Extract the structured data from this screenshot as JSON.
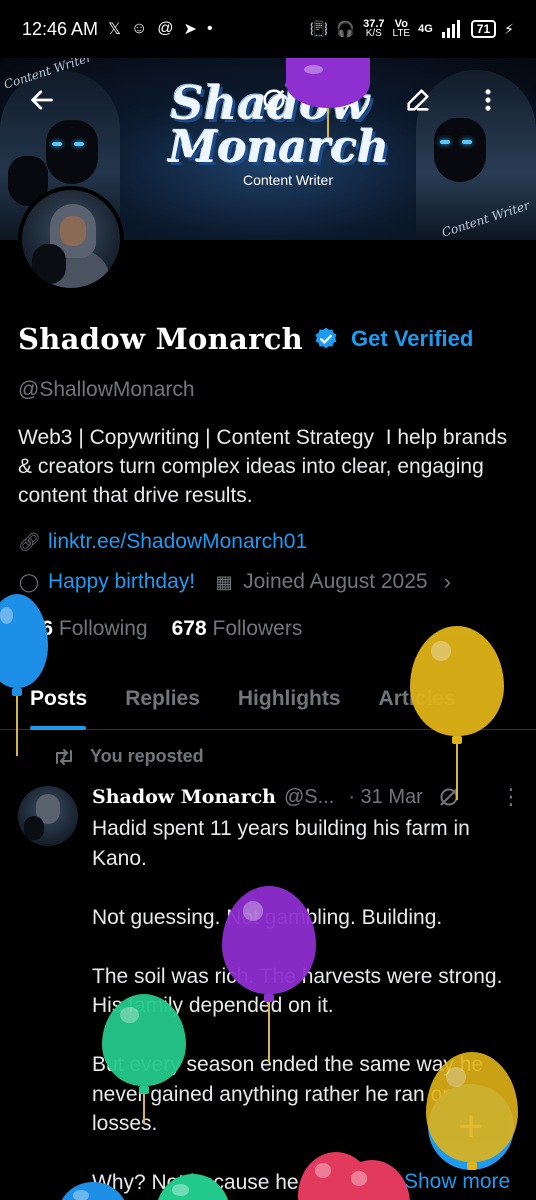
{
  "status_bar": {
    "time": "12:46 AM",
    "net_speed_value": "37.7",
    "net_speed_unit": "K/S",
    "network_top": "Vo",
    "network_bottom": "LTE",
    "network_type": "4G",
    "battery": "71"
  },
  "banner": {
    "logo_line1": "Shadow",
    "logo_line2": "Monarch",
    "logo_sub": "Content Writer",
    "script_left": "Content Writer",
    "script_right": "Content Writer"
  },
  "profile": {
    "display_name": "Shadow Monarch",
    "get_verified": "Get Verified",
    "handle": "@ShallowMonarch",
    "bio": "Web3 | Copywriting | Content Strategy  I help brands & creators turn complex ideas into clear, engaging content that drive results.",
    "link": "linktr.ee/ShadowMonarch01",
    "birthday": "Happy birthday!",
    "joined": "Joined August 2025",
    "following_count": "626",
    "following_label": "Following",
    "followers_count": "678",
    "followers_label": "Followers"
  },
  "tabs": [
    {
      "label": "Posts"
    },
    {
      "label": "Replies"
    },
    {
      "label": "Highlights"
    },
    {
      "label": "Articles"
    }
  ],
  "post": {
    "repost_label": "You reposted",
    "author_name": "Shadow Monarch",
    "author_handle": "@S...",
    "date": "· 31 Mar",
    "body": "Hadid spent 11 years building his farm in Kano.\n\nNot guessing. Not gambling. Building.\n\nThe soil was rich. The harvests were strong. His family depended on it.\n\nBut every season ended the same way he never gained anything rather he ran on losses.\n\nWhy? Not because he failed.",
    "show_more": "Show more"
  },
  "fab": {
    "icon": "+"
  },
  "icons": {
    "back": "arrow-left-icon",
    "grok": "grok-icon",
    "search": "search-icon",
    "edit": "edit-icon",
    "more": "more-vertical-icon"
  },
  "colors": {
    "accent": "#1d9bf0",
    "muted": "#71767b",
    "background": "#000000",
    "balloon_purple": "#8e2fd0",
    "balloon_yellow": "#e0b318",
    "balloon_blue": "#1d8fe6",
    "balloon_green": "#24c98c",
    "balloon_pink": "#e23a5c"
  }
}
